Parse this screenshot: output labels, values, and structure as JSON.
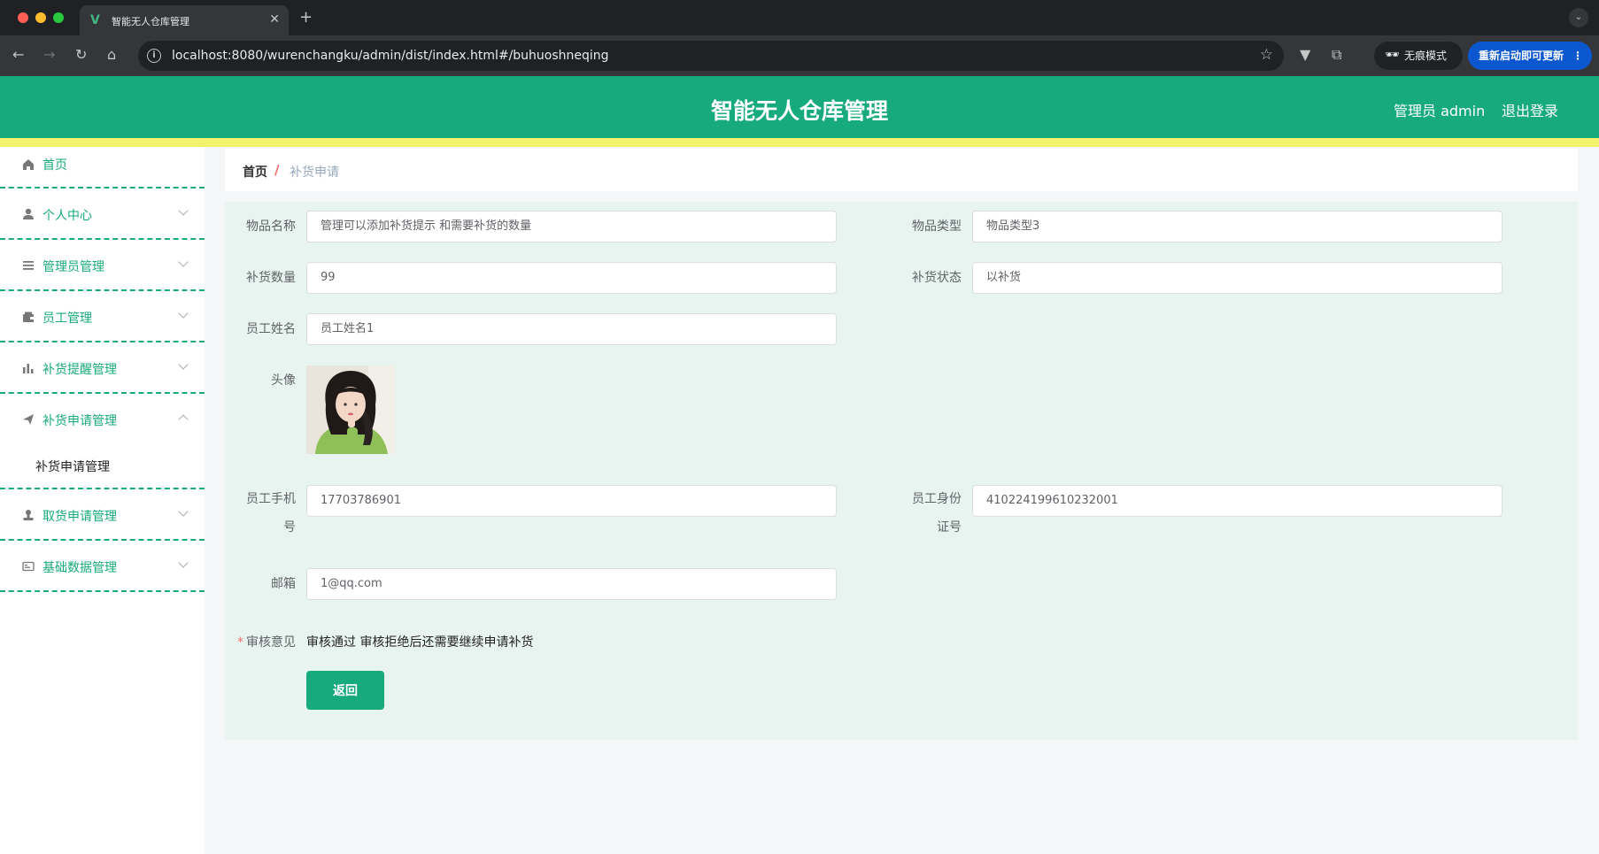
{
  "browser": {
    "tab_title": "智能无人仓库管理",
    "tab_favicon": "V",
    "new_tab": "+",
    "url": "localhost:8080/wurenchangku/admin/dist/index.html#/buhuoshneqing",
    "incognito_label": "无痕模式",
    "relaunch_label": "重新启动即可更新"
  },
  "header": {
    "title": "智能无人仓库管理",
    "user": "管理员 admin",
    "logout": "退出登录",
    "color": "#17aa7c",
    "stripe_color": "#f3f36b"
  },
  "sidebar": {
    "items": [
      {
        "label": "首页",
        "icon": "home-icon"
      },
      {
        "label": "个人中心",
        "icon": "user-icon"
      },
      {
        "label": "管理员管理",
        "icon": "list-icon"
      },
      {
        "label": "员工管理",
        "icon": "wallet-icon"
      },
      {
        "label": "补货提醒管理",
        "icon": "bar-chart-icon"
      },
      {
        "label": "补货申请管理",
        "icon": "paper-plane-icon",
        "expanded": true,
        "children": [
          {
            "label": "补货申请管理"
          }
        ]
      },
      {
        "label": "取货申请管理",
        "icon": "stamp-icon"
      },
      {
        "label": "基础数据管理",
        "icon": "id-card-icon"
      }
    ]
  },
  "breadcrumb": {
    "home": "首页",
    "separator": "/",
    "current": "补货申请"
  },
  "form": {
    "item_name": {
      "label": "物品名称",
      "value": "管理可以添加补货提示 和需要补货的数量"
    },
    "item_type": {
      "label": "物品类型",
      "value": "物品类型3"
    },
    "quantity": {
      "label": "补货数量",
      "value": "99"
    },
    "status": {
      "label": "补货状态",
      "value": "以补货"
    },
    "employee_name": {
      "label": "员工姓名",
      "value": "员工姓名1"
    },
    "avatar": {
      "label": "头像"
    },
    "phone": {
      "label_line1": "员工手机",
      "label_line2": "号",
      "value": "17703786901"
    },
    "id_card": {
      "label_line1": "员工身份",
      "label_line2": "证号",
      "value": "410224199610232001"
    },
    "email": {
      "label": "邮箱",
      "value": "1@qq.com"
    },
    "opinion": {
      "required_mark": "*",
      "label": "审核意见",
      "value": "审核通过 审核拒绝后还需要继续申请补货"
    },
    "back_button": "返回"
  }
}
